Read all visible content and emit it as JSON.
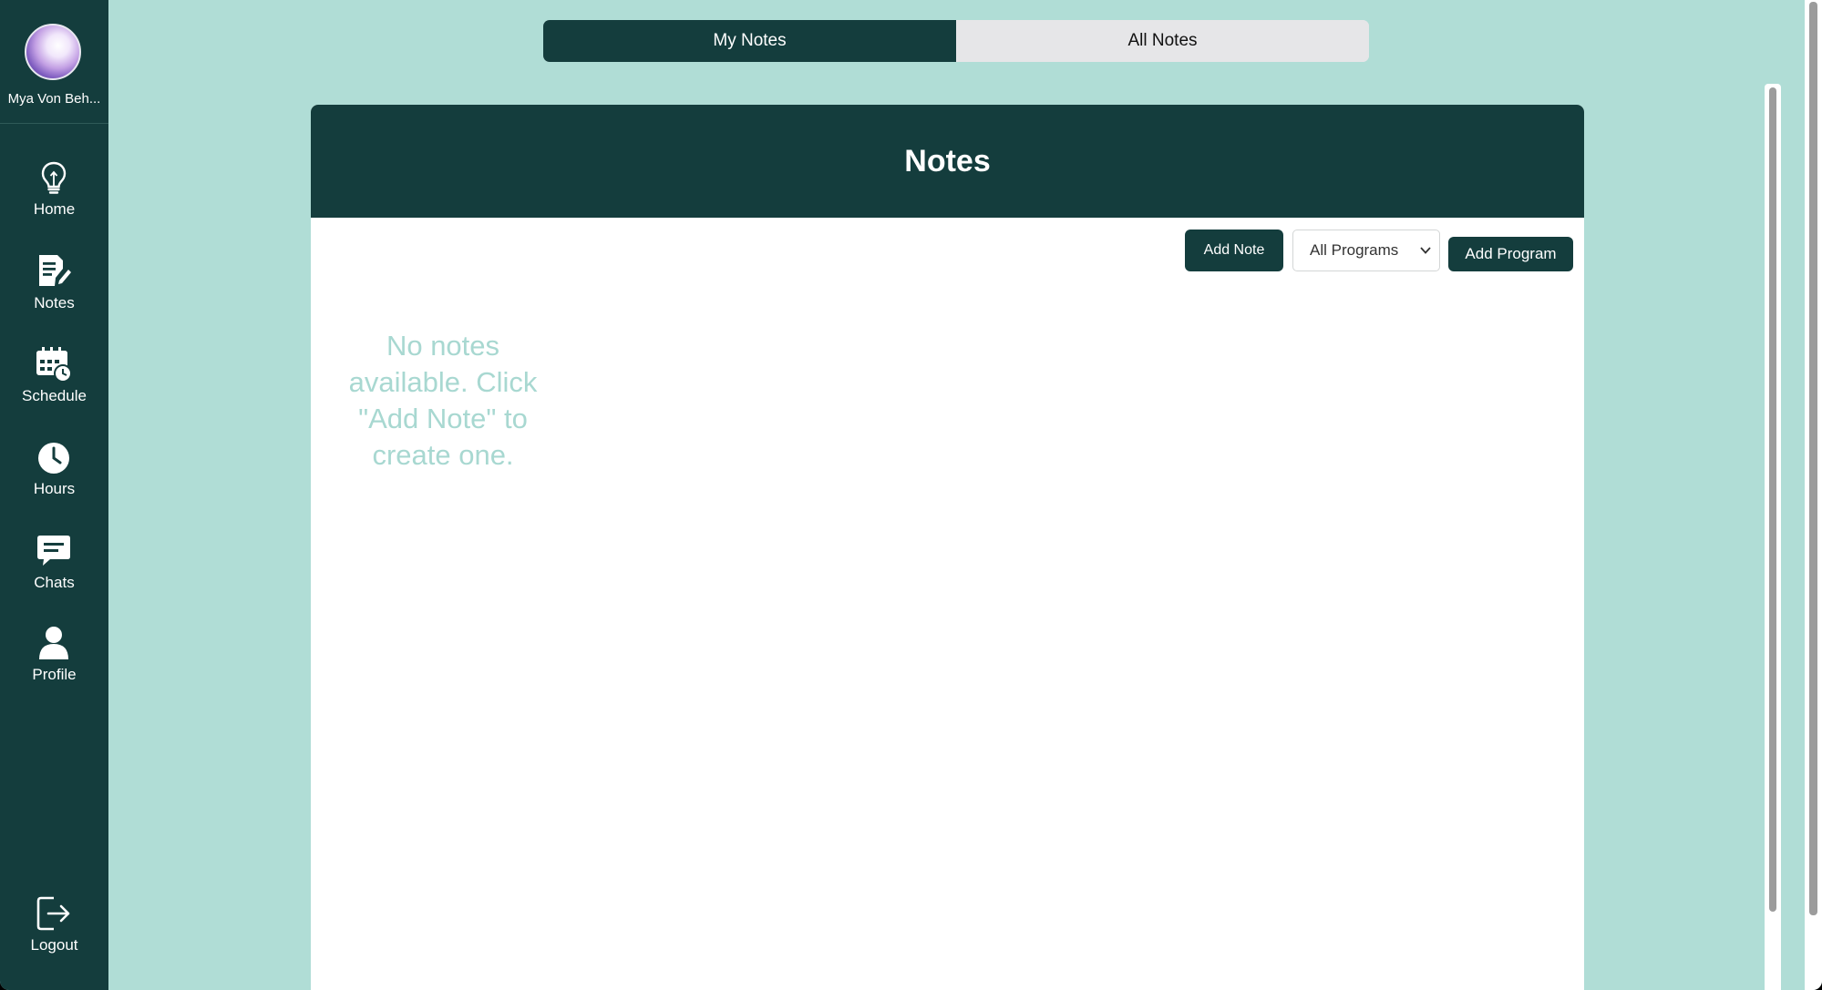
{
  "sidebar": {
    "profile_name": "Mya Von Beh...",
    "items": [
      {
        "label": "Home",
        "icon": "lightbulb-icon"
      },
      {
        "label": "Notes",
        "icon": "notes-icon"
      },
      {
        "label": "Schedule",
        "icon": "calendar-clock-icon"
      },
      {
        "label": "Hours",
        "icon": "clock-icon"
      },
      {
        "label": "Chats",
        "icon": "chat-icon"
      },
      {
        "label": "Profile",
        "icon": "user-icon"
      }
    ],
    "logout": {
      "label": "Logout",
      "icon": "logout-icon"
    }
  },
  "tabs": {
    "my_notes": "My Notes",
    "all_notes": "All Notes",
    "active": "My Notes"
  },
  "notes_panel": {
    "title": "Notes",
    "add_note_label": "Add Note",
    "program_select_value": "All Programs",
    "add_program_label": "Add Program",
    "empty_message": "No notes available. Click \"Add Note\" to create one."
  },
  "colors": {
    "primary_dark": "#143d3d",
    "background": "#b0ddd6",
    "empty_text": "#a8d8d1"
  }
}
